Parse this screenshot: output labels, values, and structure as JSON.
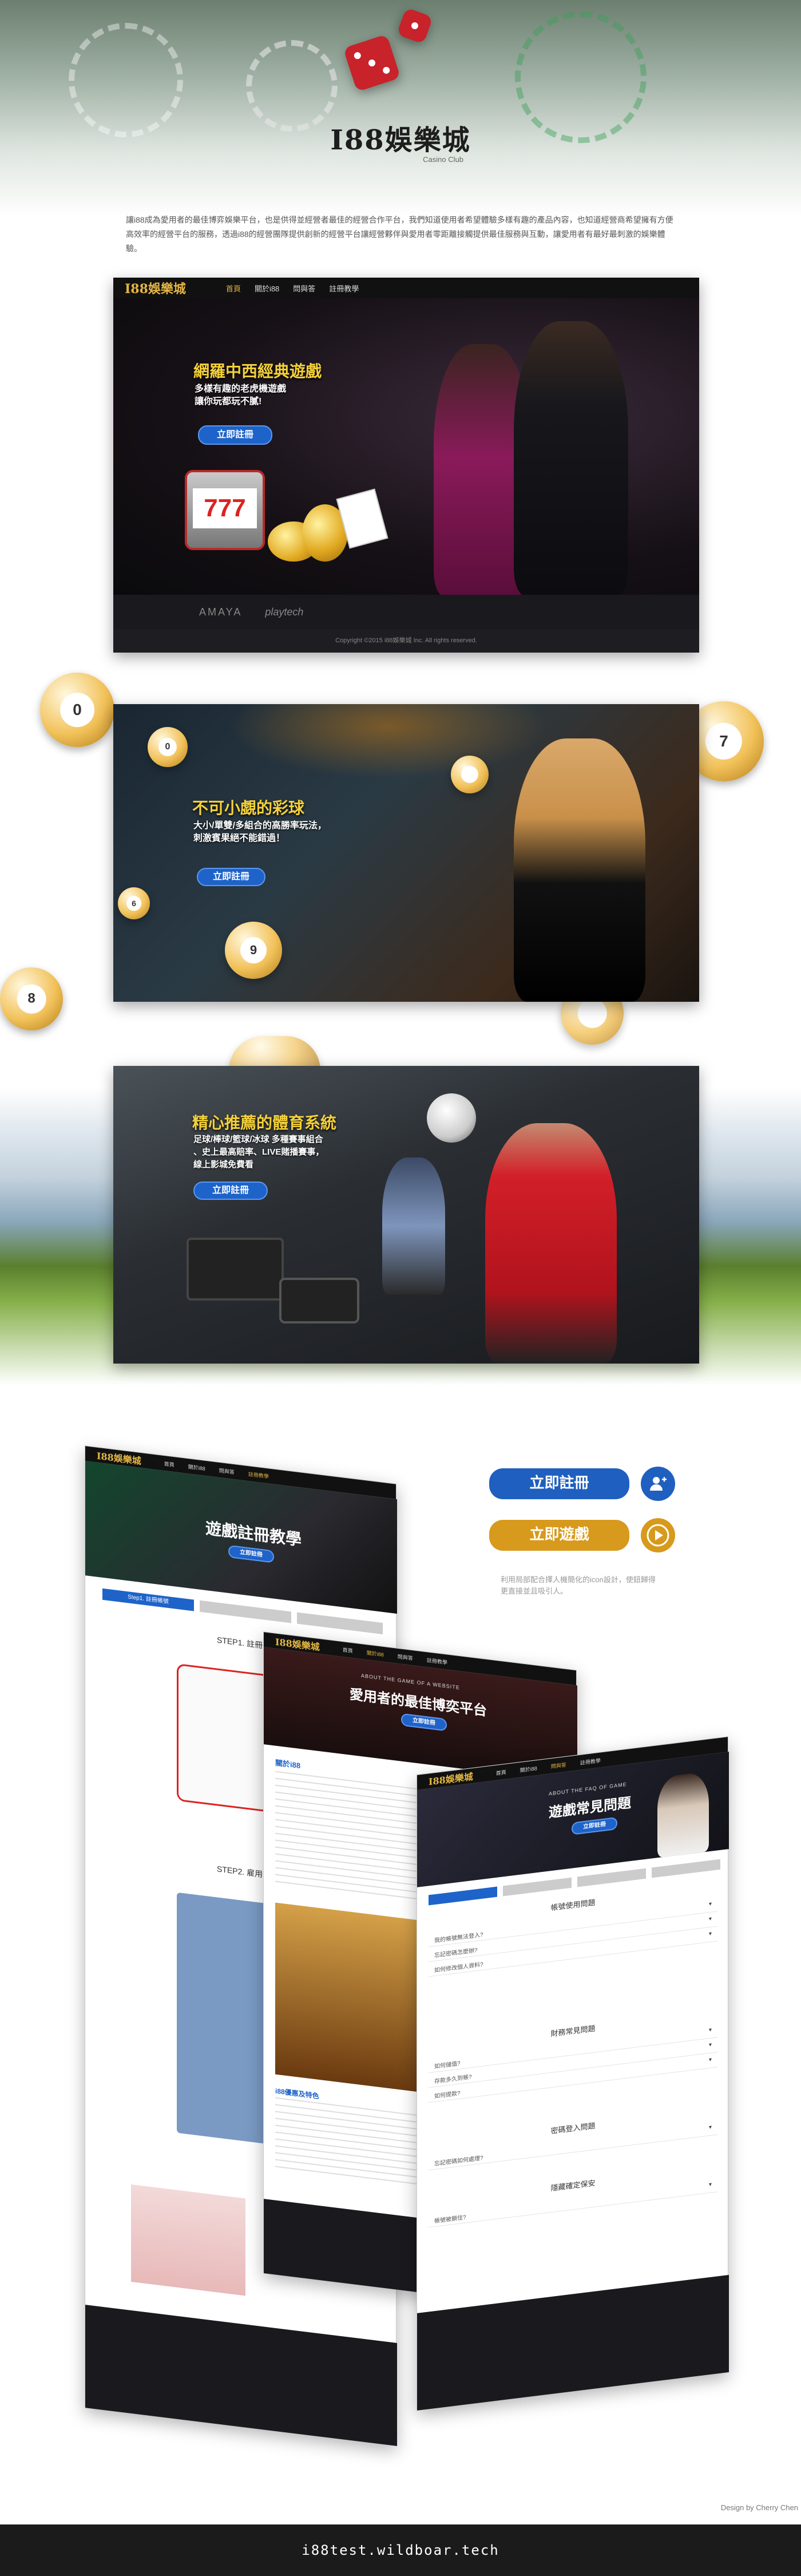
{
  "brand": {
    "logo_text": "I88娛樂城",
    "logo_sub": "Casino Club"
  },
  "intro": "讓i88成為愛用者的最佳博弈娛樂平台，也是供得並經營者最佳的經營合作平台，我們知道使用者希望體驗多樣有趣的產品內容，也知道經營商希望擁有方便高效率的經營平台的服務，透過i88的經營團隊提供創新的經營平台讓經營夥伴與愛用者零距離接觸提供最佳服務與互動，讓愛用者有最好最刺激的娛樂體驗。",
  "nav": {
    "brand": "I88娛樂城",
    "items": [
      "首頁",
      "關於i88",
      "問與答",
      "註冊教學"
    ]
  },
  "panel1": {
    "headline": "網羅中西經典遊戲",
    "sub1": "多樣有趣的老虎機遊戲",
    "sub2": "讓你玩都玩不膩!",
    "button": "立即註冊",
    "copyright": "Copyright ©2015 i88娛樂城 Inc. All rights reserved.",
    "partners": [
      "AMAYA",
      "playtech"
    ]
  },
  "panel2": {
    "headline": "不可小覷的彩球",
    "sub1": "大小/單雙/多組合的高勝率玩法，",
    "sub2": "刺激賓果絕不能錯過！",
    "button": "立即註冊",
    "ball_numbers": [
      "0",
      "0",
      "7",
      "8",
      "6",
      "9"
    ]
  },
  "panel3": {
    "headline": "精心推薦的體育系統",
    "sub1": "足球/棒球/籃球/冰球 多種賽事組合",
    "sub2": "、史上最高賠率、LIVE賭播賽事，",
    "sub3": "線上影城免費看",
    "button": "立即註冊"
  },
  "cta": {
    "register": "立即註冊",
    "play": "立即遊戲",
    "note1": "利用局部配合擇人機簡化的icon設計，使鈕歸得",
    "note2": "更直接並且吸引人。"
  },
  "pages": {
    "tutorial": {
      "title": "遊戲註冊教學",
      "tab1": "Step1. 註冊帳號",
      "step1": "STEP1. 註冊帳號",
      "step2": "STEP2. 雇用LINE...",
      "btn": "立即註冊"
    },
    "about": {
      "eyebrow": "ABOUT THE GAME OF A WEBSITE",
      "title": "愛用者的最佳博奕平台",
      "btn": "立即註冊",
      "section": "關於i88",
      "section2": "i88優惠及特色"
    },
    "faq": {
      "eyebrow": "ABOUT THE FAQ OF GAME",
      "title": "遊戲常見問題",
      "btn": "立即註冊",
      "groups": [
        "帳號使用問題",
        "財務常見問題",
        "密碼登入問題",
        "隱藏確定保安"
      ],
      "rows": [
        "我的帳號無法登入?",
        "忘記密碼怎麼辦?",
        "如何修改個人資料?",
        "如何儲值?",
        "存款多久到帳?",
        "如何提款?",
        "忘記密碼如何處理?",
        "帳號被鎖住?"
      ]
    }
  },
  "credit": "Design by Cherry Chen",
  "footer_url": "i88test.wildboar.tech"
}
